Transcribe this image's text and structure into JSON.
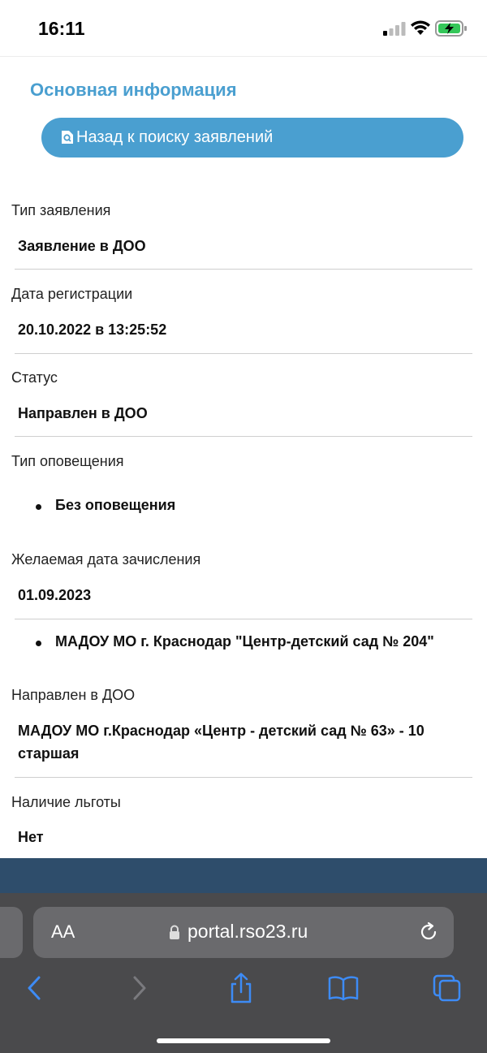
{
  "status_bar": {
    "time": "16:11"
  },
  "page": {
    "section_title": "Основная информация",
    "back_button_label": "Назад к поиску заявлений"
  },
  "fields": {
    "application_type": {
      "label": "Тип заявления",
      "value": "Заявление в ДОО"
    },
    "registration_date": {
      "label": "Дата регистрации",
      "value": "20.10.2022 в 13:25:52"
    },
    "status": {
      "label": "Статус",
      "value": "Направлен в ДОО"
    },
    "notification_type": {
      "label": "Тип оповещения",
      "items": [
        "Без оповещения"
      ]
    },
    "desired_enrollment_date": {
      "label": "Желаемая дата зачисления",
      "value": "01.09.2023"
    },
    "preferred_institutions": {
      "items": [
        "МАДОУ МО г. Краснодар \"Центр-детский сад № 204\""
      ]
    },
    "assigned_institution": {
      "label": "Направлен в ДОО",
      "value": "МАДОУ МО г.Краснодар «Центр - детский сад № 63» - 10 старшая"
    },
    "benefit": {
      "label": "Наличие льготы",
      "value": "Нет"
    }
  },
  "browser": {
    "text_size_label": "AA",
    "url": "portal.rso23.ru"
  },
  "colors": {
    "accent": "#4a9fd0",
    "footer": "#2e4d6b",
    "browser_chrome": "#4a4a4c",
    "browser_icon": "#3d8bf5"
  }
}
